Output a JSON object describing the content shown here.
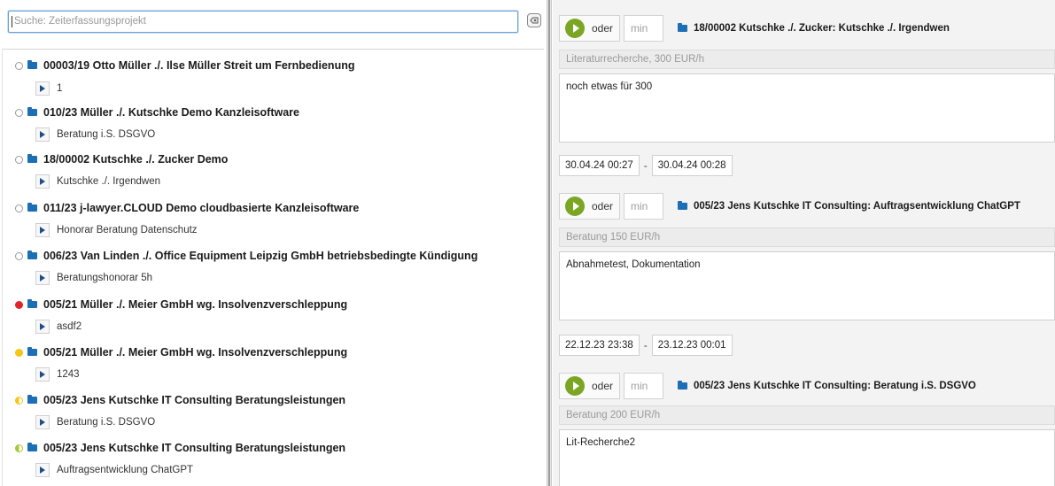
{
  "search": {
    "placeholder": "Suche: Zeiterfassungsprojekt",
    "clear_icon": "clear-search-icon"
  },
  "colors": {
    "folder": "#1c6fb5",
    "play": "#7aa623",
    "status_red": "#e0252b",
    "status_yellow": "#f5c518",
    "status_lime": "#a6c832"
  },
  "projects": [
    {
      "title": "00003/19 Otto Müller ./. Ilse Müller Streit um Fernbedienung",
      "status": "empty",
      "sub": "1"
    },
    {
      "title": "010/23 Müller ./. Kutschke Demo Kanzleisoftware",
      "status": "empty",
      "sub": "Beratung i.S. DSGVO"
    },
    {
      "title": "18/00002 Kutschke ./. Zucker Demo",
      "status": "empty",
      "sub": "Kutschke ./. Irgendwen"
    },
    {
      "title": "011/23 j-lawyer.CLOUD Demo cloudbasierte Kanzleisoftware",
      "status": "empty",
      "sub": "Honorar Beratung Datenschutz"
    },
    {
      "title": "006/23 Van Linden ./. Office Equipment Leipzig GmbH betriebsbedingte Kündigung",
      "status": "empty",
      "sub": "Beratungshonorar 5h"
    },
    {
      "title": "005/21 Müller ./. Meier GmbH wg. Insolvenzverschleppung",
      "status": "red",
      "sub": "asdf2"
    },
    {
      "title": "005/21 Müller ./. Meier GmbH wg. Insolvenzverschleppung",
      "status": "yellow",
      "sub": "1243"
    },
    {
      "title": "005/23 Jens Kutschke IT Consulting Beratungsleistungen",
      "status": "half-yellow",
      "sub": "Beratung i.S. DSGVO"
    },
    {
      "title": "005/23 Jens Kutschke IT Consulting Beratungsleistungen",
      "status": "half-lime",
      "sub": "Auftragsentwicklung ChatGPT"
    }
  ],
  "entries": [
    {
      "oder": "oder",
      "min_placeholder": "min",
      "title": "18/00002 Kutschke ./. Zucker: Kutschke ./. Irgendwen",
      "rate": "Literaturrecherche, 300 EUR/h",
      "description": "noch etwas für 300",
      "start": "30.04.24 00:27",
      "end": "30.04.24 00:28"
    },
    {
      "oder": "oder",
      "min_placeholder": "min",
      "title": "005/23 Jens Kutschke IT Consulting: Auftragsentwicklung ChatGPT",
      "rate": "Beratung 150 EUR/h",
      "description": "Abnahmetest, Dokumentation",
      "start": "22.12.23 23:38",
      "end": "23.12.23 00:01"
    },
    {
      "oder": "oder",
      "min_placeholder": "min",
      "title": "005/23 Jens Kutschke IT Consulting: Beratung i.S. DSGVO",
      "rate": "Beratung 200 EUR/h",
      "description": "Lit-Recherche2",
      "start": "",
      "end": ""
    }
  ],
  "time_separator": "-"
}
